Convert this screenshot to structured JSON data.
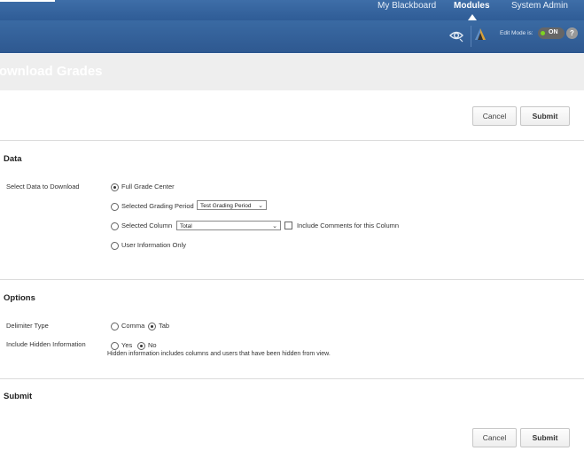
{
  "topnav": {
    "links": [
      "My Blackboard",
      "Modules",
      "System Admin"
    ],
    "active": "Modules"
  },
  "subbar": {
    "edit_mode_label": "Edit Mode is:",
    "edit_mode_value": "ON",
    "help_label": "?"
  },
  "page": {
    "title": "Download Grades"
  },
  "buttons": {
    "cancel": "Cancel",
    "submit": "Submit"
  },
  "data_section": {
    "title": "Data",
    "field_label": "Select Data to Download",
    "options": {
      "full": "Full Grade Center",
      "grading_period": "Selected Grading Period",
      "column": "Selected Column",
      "user_info": "User Information Only"
    },
    "selected": "Full Grade Center",
    "grading_period_value": "Test Grading Period",
    "column_value": "Total",
    "include_comments_label": "Include Comments for this Column"
  },
  "options_section": {
    "title": "Options",
    "delimiter_label": "Delimiter Type",
    "delimiter_options": [
      "Comma",
      "Tab"
    ],
    "delimiter_selected": "Tab",
    "hidden_label": "Include Hidden Information",
    "hidden_options": [
      "Yes",
      "No"
    ],
    "hidden_selected": "No",
    "hidden_note": "Hidden information includes columns and users that have been hidden from view."
  },
  "submit_section": {
    "title": "Submit"
  },
  "colors": {
    "nav_blue": "#2f5c96",
    "toggle_green": "#7ed321"
  }
}
